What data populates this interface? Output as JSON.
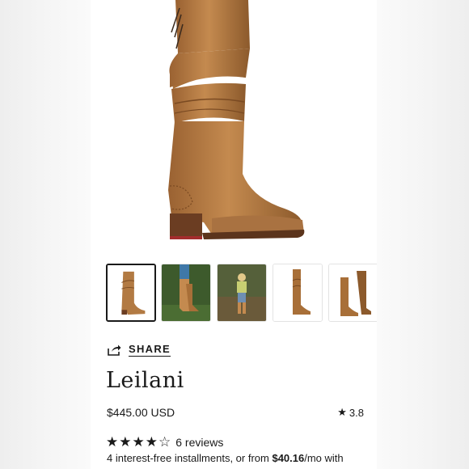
{
  "product": {
    "share_label": "SHARE",
    "name": "Leilani",
    "price": "$445.00 USD",
    "rating_short": "3.8",
    "rating_stars": 4,
    "rating_max": 5,
    "reviews_label": "6 reviews",
    "installments": {
      "prefix": "4 interest-free installments, or from ",
      "amount": "$40.16",
      "suffix": "/mo with"
    }
  },
  "gallery": {
    "selected_index": 0,
    "thumbnails": [
      {
        "icon": "boot-product-icon"
      },
      {
        "icon": "boot-worn-outdoor-icon"
      },
      {
        "icon": "model-in-forest-icon"
      },
      {
        "icon": "boot-side-icon"
      },
      {
        "icon": "boot-pair-icon"
      }
    ]
  },
  "colors": {
    "leather": "#b27a43",
    "leather_dark": "#7a4a22",
    "sole": "#6b3d22",
    "heel_accent": "#a32d2d",
    "text": "#1a1a1a"
  }
}
